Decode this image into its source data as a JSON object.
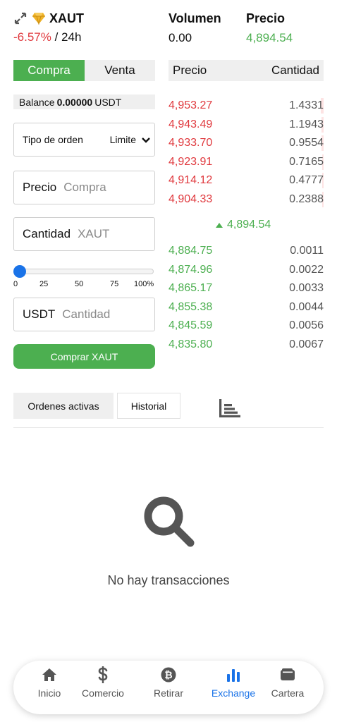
{
  "header": {
    "pair": "XAUT",
    "change": "-6.57%",
    "change_suffix": " / 24h",
    "volume_label": "Volumen",
    "volume_value": "0.00",
    "price_label": "Precio",
    "price_value": "4,894.54"
  },
  "trade_tabs": {
    "buy": "Compra",
    "sell": "Venta"
  },
  "balance": {
    "label": "Balance",
    "amount": "0.00000",
    "currency": "USDT"
  },
  "order_type": {
    "label": "Tipo de orden",
    "selected": "Limite"
  },
  "price_field": {
    "label": "Precio",
    "placeholder": "Compra"
  },
  "amount_field": {
    "label": "Cantidad",
    "placeholder": "XAUT"
  },
  "slider": {
    "value_percent": 0,
    "ticks": [
      "0",
      "25",
      "50",
      "75",
      "100%"
    ]
  },
  "total_field": {
    "label": "USDT",
    "placeholder": "Cantidad"
  },
  "buy_button": "Comprar XAUT",
  "order_book": {
    "headers": {
      "price": "Precio",
      "amount": "Cantidad"
    },
    "asks": [
      {
        "price": "4,953.27",
        "amount": "1.4331"
      },
      {
        "price": "4,943.49",
        "amount": "1.1943"
      },
      {
        "price": "4,933.70",
        "amount": "0.9554"
      },
      {
        "price": "4,923.91",
        "amount": "0.7165"
      },
      {
        "price": "4,914.12",
        "amount": "0.4777"
      },
      {
        "price": "4,904.33",
        "amount": "0.2388"
      }
    ],
    "last_price": "4,894.54",
    "bids": [
      {
        "price": "4,884.75",
        "amount": "0.0011"
      },
      {
        "price": "4,874.96",
        "amount": "0.0022"
      },
      {
        "price": "4,865.17",
        "amount": "0.0033"
      },
      {
        "price": "4,855.38",
        "amount": "0.0044"
      },
      {
        "price": "4,845.59",
        "amount": "0.0056"
      },
      {
        "price": "4,835.80",
        "amount": "0.0067"
      }
    ]
  },
  "orders_tabs": {
    "active": "Ordenes activas",
    "history": "Historial"
  },
  "empty_state": "No hay transacciones",
  "nav": {
    "items": [
      {
        "label": "Inicio",
        "icon": "home-icon"
      },
      {
        "label": "Comercio",
        "icon": "dollar-icon"
      },
      {
        "label": "Retirar",
        "icon": "bitcoin-icon"
      },
      {
        "label": "Exchange",
        "icon": "bar-chart-icon"
      },
      {
        "label": "Cartera",
        "icon": "wallet-icon"
      }
    ],
    "active_index": 3
  },
  "colors": {
    "positive": "#4caf50",
    "negative": "#e0393e",
    "accent": "#1a73e8"
  }
}
